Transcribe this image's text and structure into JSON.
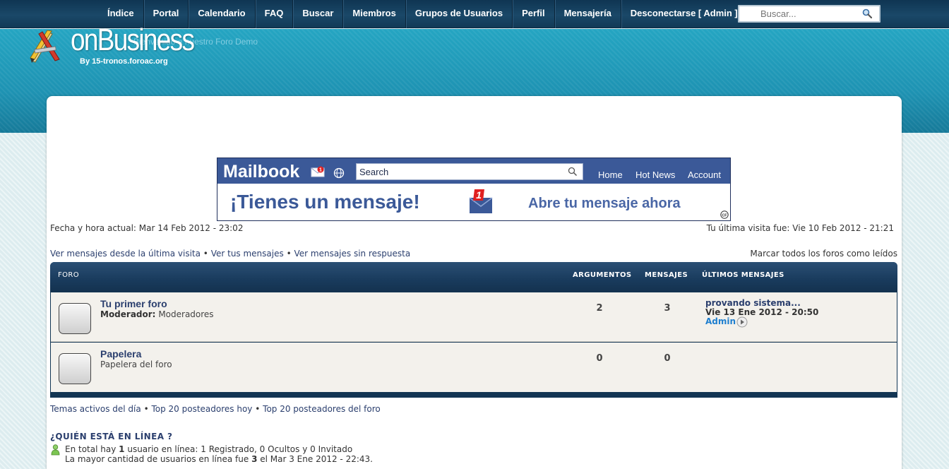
{
  "nav": {
    "items": [
      "Índice",
      "Portal",
      "Calendario",
      "FAQ",
      "Buscar",
      "Miembros",
      "Grupos de Usuarios",
      "Perfil",
      "Mensajería",
      "Desconectarse [ Admin ]"
    ],
    "search_placeholder": "Buscar..."
  },
  "header": {
    "welcome": "Bienvenido a nuestro Foro Demo",
    "logo": "onBusiness",
    "logo_sub": "By 15-tronos.foroac.org"
  },
  "banner": {
    "brand": "Mailbook",
    "search_text": "Search",
    "links": [
      "Home",
      "Hot News",
      "Account"
    ],
    "headline": "¡Tienes un mensaje!",
    "cta": "Abre tu mensaje ahora",
    "badge": "1"
  },
  "info": {
    "current_time": "Fecha y hora actual: Mar 14 Feb 2012 - 23:02",
    "last_visit": "Tu última visita fue: Vie 10 Feb 2012 - 21:21",
    "links": [
      "Ver mensajes desde la última visita",
      "Ver tus mensajes",
      "Ver mensajes sin respuesta"
    ],
    "mark_read": "Marcar todos los foros como leídos",
    "bottom_links": [
      "Temas activos del día",
      "Top 20 posteadores hoy",
      "Top 20 posteadores del foro"
    ]
  },
  "forum_table": {
    "headers": {
      "forum": "FORO",
      "topics": "ARGUMENTOS",
      "posts": "MENSAJES",
      "last": "ÚLTIMOS MENSAJES"
    },
    "rows": [
      {
        "title": "Tu primer foro",
        "moderator_label": "Moderador:",
        "moderator": "Moderadores",
        "topics": "2",
        "posts": "3",
        "last_title": "provando sistema...",
        "last_date": "Vie 13 Ene 2012 - 20:50",
        "last_author": "Admin"
      },
      {
        "title": "Papelera",
        "description": "Papelera del foro",
        "topics": "0",
        "posts": "0"
      }
    ]
  },
  "online": {
    "title": "¿QUIÉN ESTÁ EN LÍNEA ?",
    "line1_prefix": "En total hay",
    "line1_count": "1",
    "line1_suffix": "usuario en línea: 1 Registrado, 0 Ocultos y 0 Invitado",
    "line2_prefix": "La mayor cantidad de usuarios en línea fue",
    "line2_count": "3",
    "line2_suffix": "el Mar 3 Ene 2012 - 22:43."
  }
}
